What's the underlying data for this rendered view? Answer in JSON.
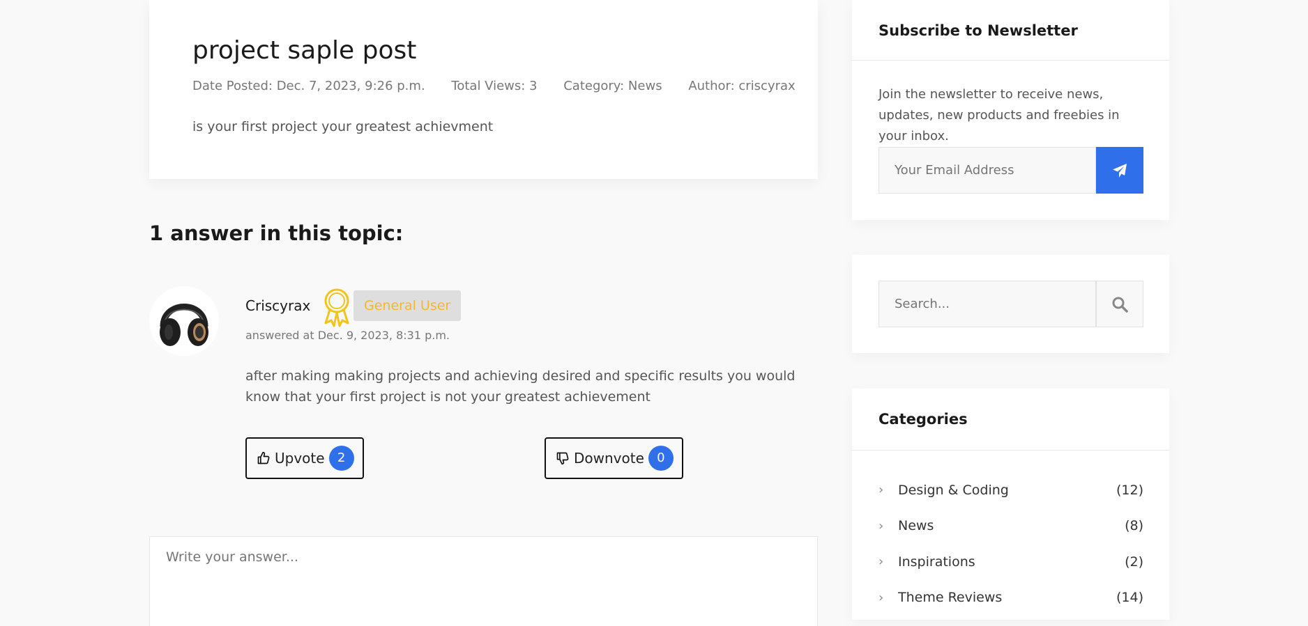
{
  "post": {
    "title": "project saple post",
    "date_posted": "Date Posted: Dec. 7, 2023, 9:26 p.m.",
    "total_views": "Total Views: 3",
    "category": "Category: News",
    "author": "Author: criscyrax",
    "body": "is your first project your greatest achievment"
  },
  "answers": {
    "heading": "1 answer in this topic:",
    "items": [
      {
        "author": "Criscyrax",
        "role": "General User",
        "answered_at": "answered at Dec. 9, 2023, 8:31 p.m.",
        "text": "after making making projects and achieving desired and specific results you would know that your first project is not your greatest achievement",
        "upvote_label": "Upvote",
        "upvotes": "2",
        "downvote_label": "Downvote",
        "downvotes": "0"
      }
    ]
  },
  "answer_form": {
    "placeholder": "Write your answer..."
  },
  "sidebar": {
    "newsletter": {
      "title": "Subscribe to Newsletter",
      "description": "Join the newsletter to receive news, updates, new products and freebies in your inbox.",
      "email_placeholder": "Your Email Address",
      "submit_icon": "paper-plane-icon"
    },
    "search": {
      "placeholder": "Search...",
      "icon": "search-icon"
    },
    "categories": {
      "title": "Categories",
      "items": [
        {
          "name": "Design & Coding",
          "count": "(12)"
        },
        {
          "name": "News",
          "count": "(8)"
        },
        {
          "name": "Inspirations",
          "count": "(2)"
        },
        {
          "name": "Theme Reviews",
          "count": "(14)"
        }
      ]
    }
  },
  "colors": {
    "accent": "#2f6fea",
    "badge_text": "#f3b82b",
    "badge_bg": "#dedede"
  }
}
